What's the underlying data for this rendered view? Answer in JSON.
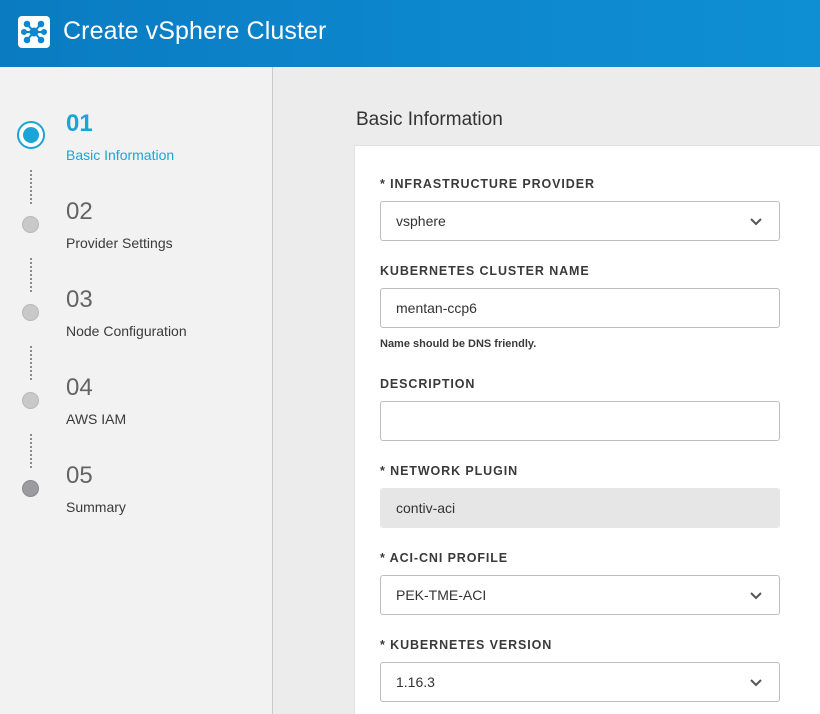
{
  "app": {
    "title": "Create vSphere Cluster",
    "logo_icon": "cluster-logo-icon",
    "header_color": "#0d88cf"
  },
  "steps": [
    {
      "number": "01",
      "label": "Basic Information",
      "state": "active"
    },
    {
      "number": "02",
      "label": "Provider Settings",
      "state": "pending"
    },
    {
      "number": "03",
      "label": "Node Configuration",
      "state": "pending"
    },
    {
      "number": "04",
      "label": "AWS IAM",
      "state": "pending"
    },
    {
      "number": "05",
      "label": "Summary",
      "state": "pending"
    }
  ],
  "accent_color": "#1aa5d9",
  "form": {
    "section_title": "Basic Information",
    "infrastructure_provider": {
      "label": "* INFRASTRUCTURE PROVIDER",
      "value": "vsphere"
    },
    "cluster_name": {
      "label": "KUBERNETES CLUSTER NAME",
      "value": "mentan-ccp6",
      "hint": "Name should be DNS friendly."
    },
    "description": {
      "label": "DESCRIPTION",
      "value": ""
    },
    "network_plugin": {
      "label": "* NETWORK PLUGIN",
      "value": "contiv-aci"
    },
    "aci_cni_profile": {
      "label": "* ACI-CNI PROFILE",
      "value": "PEK-TME-ACI"
    },
    "kubernetes_version": {
      "label": "* KUBERNETES VERSION",
      "value": "1.16.3"
    }
  }
}
